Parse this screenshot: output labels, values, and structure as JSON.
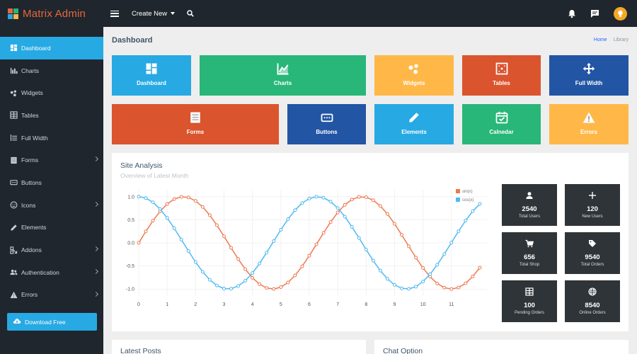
{
  "brand": {
    "name": "Matrix Admin"
  },
  "topbar": {
    "create_new": "Create New"
  },
  "sidebar": {
    "items": [
      {
        "label": "Dashboard",
        "icon": "dashboard-icon",
        "active": true
      },
      {
        "label": "Charts",
        "icon": "bar-chart-icon"
      },
      {
        "label": "Widgets",
        "icon": "widgets-icon"
      },
      {
        "label": "Tables",
        "icon": "table-icon"
      },
      {
        "label": "Full Width",
        "icon": "full-width-icon"
      },
      {
        "label": "Forms",
        "icon": "form-icon",
        "has_children": true
      },
      {
        "label": "Buttons",
        "icon": "buttons-icon"
      },
      {
        "label": "Icons",
        "icon": "face-icon",
        "has_children": true
      },
      {
        "label": "Elements",
        "icon": "pencil-icon"
      },
      {
        "label": "Addons",
        "icon": "addons-icon",
        "has_children": true
      },
      {
        "label": "Authentication",
        "icon": "users-icon",
        "has_children": true
      },
      {
        "label": "Errors",
        "icon": "warning-icon",
        "has_children": true
      }
    ],
    "download": "Download Free"
  },
  "page": {
    "title": "Dashboard",
    "breadcrumb": {
      "home": "Home",
      "current": "Library"
    }
  },
  "tiles": [
    {
      "label": "Dashboard",
      "color": "#27a9e3",
      "icon": "dashboard-icon"
    },
    {
      "label": "Charts",
      "color": "#28b779",
      "icon": "line-chart-icon"
    },
    {
      "label": "Widgets",
      "color": "#ffb848",
      "icon": "widgets-icon"
    },
    {
      "label": "Tables",
      "color": "#da542e",
      "icon": "tables-icon"
    },
    {
      "label": "Full Width",
      "color": "#2255a4",
      "icon": "arrows-icon"
    },
    {
      "label": "Forms",
      "color": "#da542e",
      "icon": "form-icon"
    },
    {
      "label": "Buttons",
      "color": "#2255a4",
      "icon": "buttons-icon"
    },
    {
      "label": "Elements",
      "color": "#27a9e3",
      "icon": "pencil-icon"
    },
    {
      "label": "Calnedar",
      "color": "#28b779",
      "icon": "calendar-icon"
    },
    {
      "label": "Errors",
      "color": "#ffb848",
      "icon": "warning-icon"
    }
  ],
  "analysis": {
    "title": "Site Analysis",
    "subtitle": "Overview of Latest Month"
  },
  "chart_data": {
    "type": "line",
    "legend": [
      "sin(x)",
      "cos(x)"
    ],
    "legend_position": "top-right",
    "xlim": [
      0,
      12.25
    ],
    "ylim": [
      -1.15,
      1.15
    ],
    "x_ticks": [
      0,
      1,
      2,
      3,
      4,
      5,
      6,
      7,
      8,
      9,
      10,
      11
    ],
    "y_ticks": [
      "1.0",
      "0.5",
      "0.0",
      "-0.5",
      "-1.0"
    ],
    "y_tick_values": [
      1,
      0.5,
      0,
      -0.5,
      -1
    ],
    "grid": true,
    "x": [
      0,
      0.25,
      0.5,
      0.75,
      1,
      1.25,
      1.5,
      1.75,
      2,
      2.25,
      2.5,
      2.75,
      3,
      3.25,
      3.5,
      3.75,
      4,
      4.25,
      4.5,
      4.75,
      5,
      5.25,
      5.5,
      5.75,
      6,
      6.25,
      6.5,
      6.75,
      7,
      7.25,
      7.5,
      7.75,
      8,
      8.25,
      8.5,
      8.75,
      9,
      9.25,
      9.5,
      9.75,
      10,
      10.25,
      10.5,
      10.75,
      11,
      11.25,
      11.5,
      11.75,
      12
    ],
    "series": [
      {
        "name": "sin(x)",
        "color": "#ee7951",
        "values": [
          0,
          0.247,
          0.479,
          0.682,
          0.841,
          0.949,
          0.997,
          0.984,
          0.909,
          0.778,
          0.598,
          0.382,
          0.141,
          -0.108,
          -0.351,
          -0.572,
          -0.757,
          -0.895,
          -0.978,
          -0.999,
          -0.959,
          -0.859,
          -0.706,
          -0.508,
          -0.279,
          -0.033,
          0.215,
          0.45,
          0.657,
          0.823,
          0.938,
          0.994,
          0.989,
          0.923,
          0.798,
          0.625,
          0.412,
          0.174,
          -0.075,
          -0.32,
          -0.544,
          -0.734,
          -0.88,
          -0.97,
          -1,
          -0.967,
          -0.876,
          -0.728,
          -0.537
        ]
      },
      {
        "name": "cos(x)",
        "color": "#4fb9f0",
        "values": [
          1,
          0.969,
          0.878,
          0.732,
          0.54,
          0.315,
          0.071,
          -0.178,
          -0.416,
          -0.628,
          -0.801,
          -0.924,
          -0.99,
          -0.994,
          -0.936,
          -0.82,
          -0.654,
          -0.447,
          -0.211,
          0.038,
          0.284,
          0.512,
          0.709,
          0.861,
          0.96,
          0.999,
          0.977,
          0.893,
          0.754,
          0.568,
          0.347,
          0.105,
          -0.146,
          -0.386,
          -0.602,
          -0.781,
          -0.911,
          -0.985,
          -0.997,
          -0.948,
          -0.839,
          -0.679,
          -0.476,
          -0.243,
          0.004,
          0.252,
          0.483,
          0.686,
          0.844
        ]
      }
    ]
  },
  "stats": [
    {
      "value": "2540",
      "label": "Total Users",
      "icon": "user-icon"
    },
    {
      "value": "120",
      "label": "New Users",
      "icon": "plus-icon"
    },
    {
      "value": "656",
      "label": "Total Shop",
      "icon": "cart-icon"
    },
    {
      "value": "9540",
      "label": "Total Orders",
      "icon": "tag-icon"
    },
    {
      "value": "100",
      "label": "Pending Orders",
      "icon": "table-icon"
    },
    {
      "value": "8540",
      "label": "Online Orders",
      "icon": "globe-icon"
    }
  ],
  "bottom": {
    "latest_posts": "Latest Posts",
    "chat_option": "Chat Option"
  }
}
